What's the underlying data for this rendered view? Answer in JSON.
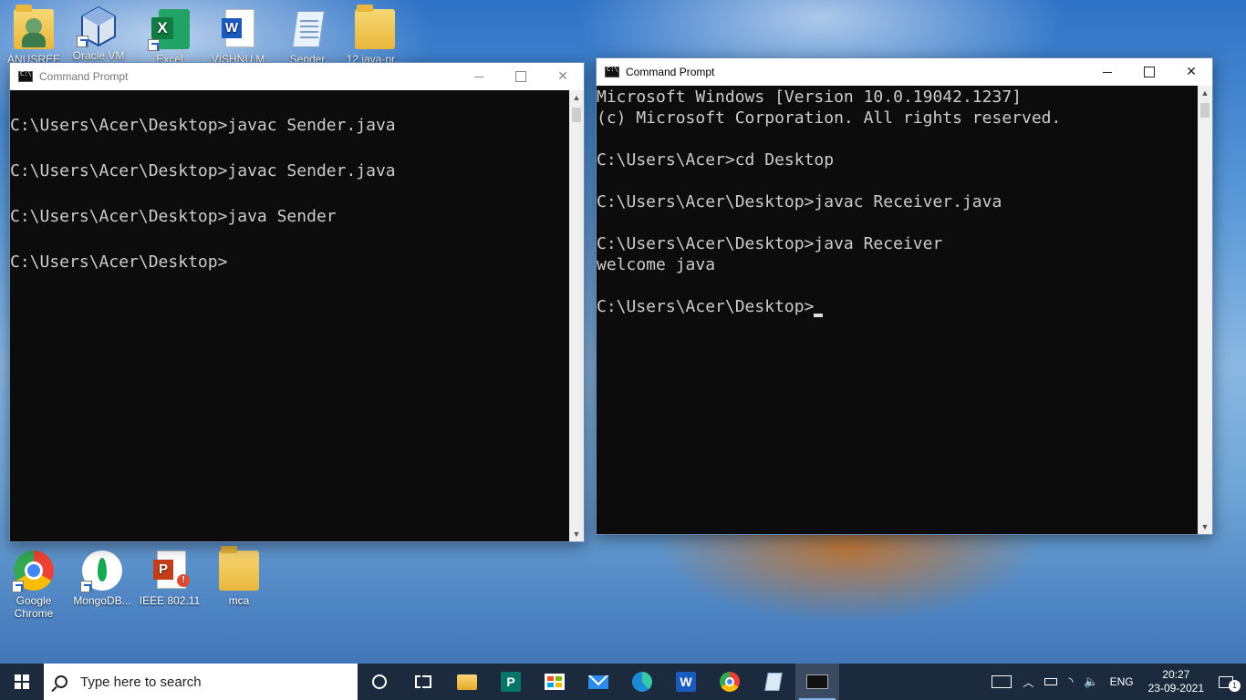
{
  "desktop": {
    "top_icons": [
      {
        "label": "ANUSREE",
        "icon": "user-folder-icon"
      },
      {
        "label": "Oracle VM",
        "icon": "virtualbox-icon"
      },
      {
        "label": "Excel",
        "icon": "excel-icon"
      },
      {
        "label": "VISHNU M",
        "icon": "word-document-icon"
      },
      {
        "label": "Sender",
        "icon": "notepad-file-icon"
      },
      {
        "label": "12 java-pr...",
        "icon": "folder-icon"
      }
    ],
    "bottom_icons": [
      {
        "label": "Google Chrome",
        "icon": "chrome-icon"
      },
      {
        "label": "MongoDB...",
        "icon": "mongodb-icon"
      },
      {
        "label": "IEEE 802.11",
        "icon": "powerpoint-file-icon"
      },
      {
        "label": "mca",
        "icon": "folder-icon"
      }
    ]
  },
  "window_left": {
    "title": "Command Prompt",
    "state": "inactive",
    "lines": [
      "",
      "C:\\Users\\Acer\\Desktop>javac Sender.java",
      "",
      "C:\\Users\\Acer\\Desktop>javac Sender.java",
      "",
      "C:\\Users\\Acer\\Desktop>java Sender",
      "",
      "C:\\Users\\Acer\\Desktop>"
    ]
  },
  "window_right": {
    "title": "Command Prompt",
    "state": "active",
    "lines": [
      "Microsoft Windows [Version 10.0.19042.1237]",
      "(c) Microsoft Corporation. All rights reserved.",
      "",
      "C:\\Users\\Acer>cd Desktop",
      "",
      "C:\\Users\\Acer\\Desktop>javac Receiver.java",
      "",
      "C:\\Users\\Acer\\Desktop>java Receiver",
      "welcome java",
      "",
      "C:\\Users\\Acer\\Desktop>"
    ]
  },
  "window_controls": {
    "minimize": "minimize-icon",
    "maximize": "maximize-icon",
    "close": "✕"
  },
  "taskbar": {
    "search_placeholder": "Type here to search",
    "pinned": [
      {
        "name": "cortana",
        "icon": "cortana-circle-icon"
      },
      {
        "name": "task-view",
        "icon": "task-view-icon"
      },
      {
        "name": "file-explorer",
        "icon": "folder-icon"
      },
      {
        "name": "publisher",
        "icon": "publisher-icon"
      },
      {
        "name": "store",
        "icon": "store-bag-icon"
      },
      {
        "name": "mail",
        "icon": "mail-icon"
      },
      {
        "name": "edge",
        "icon": "edge-icon"
      },
      {
        "name": "word",
        "icon": "word-icon"
      },
      {
        "name": "chrome",
        "icon": "chrome-icon"
      },
      {
        "name": "notepad",
        "icon": "notepad-icon"
      },
      {
        "name": "command-prompt",
        "icon": "cmd-icon",
        "active": true
      }
    ],
    "tray": {
      "language": "ENG",
      "time": "20:27",
      "date": "23-09-2021",
      "notification_count": "1"
    }
  },
  "colors": {
    "console_bg": "#0c0c0c",
    "console_text": "#cccccc",
    "taskbar_bg": "#1b2a3c",
    "titlebar_bg": "#ffffff"
  }
}
